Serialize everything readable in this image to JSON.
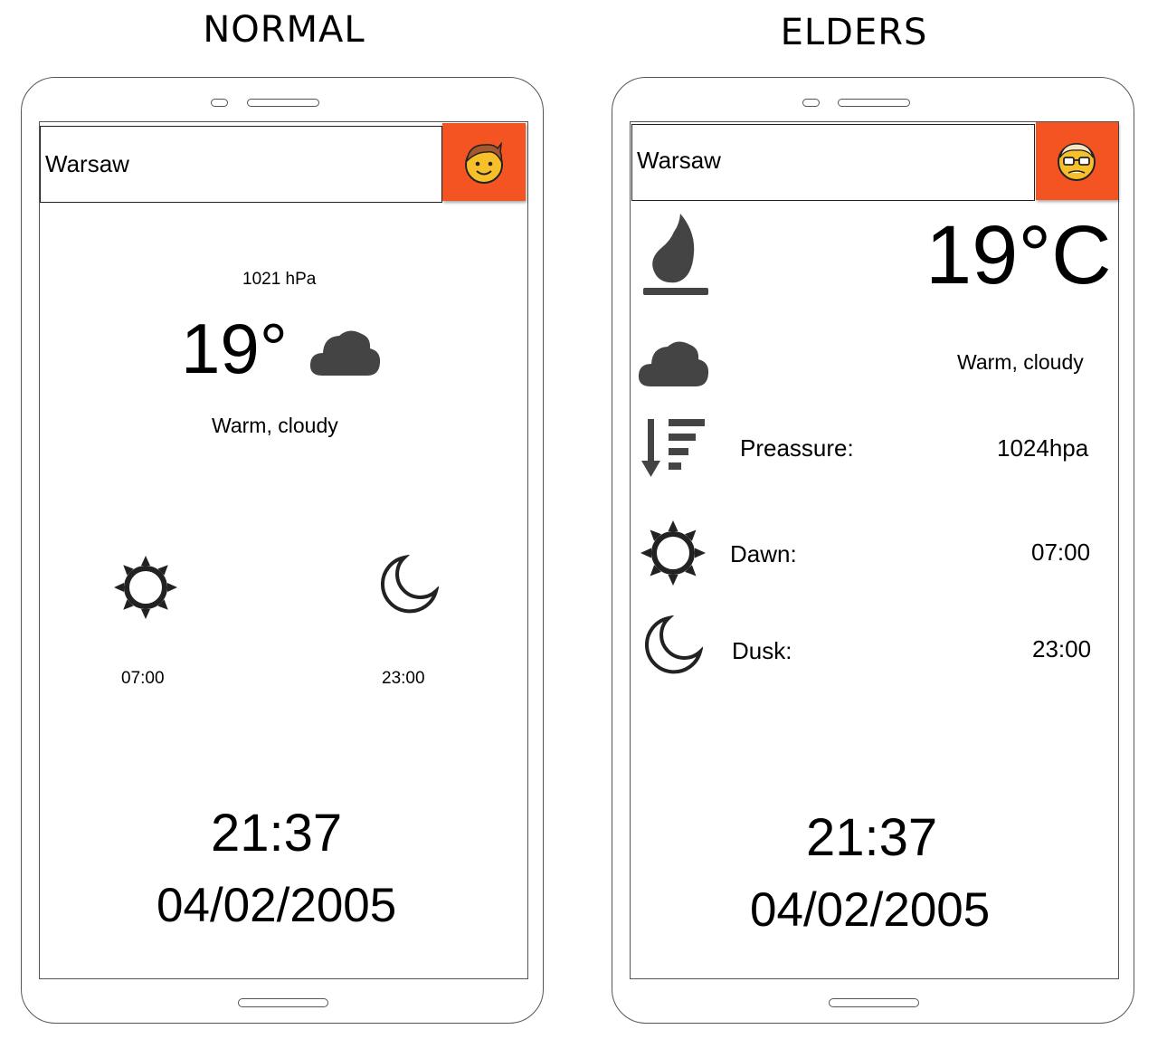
{
  "normal": {
    "mode_title": "NORMAL",
    "search": {
      "value": "Warsaw"
    },
    "profile": {
      "icon": "young-face-icon"
    },
    "pressure": "1021 hPa",
    "temperature": "19°",
    "weather_icon": "cloud-icon",
    "condition": "Warm, cloudy",
    "sunrise": {
      "icon": "sun-icon",
      "time": "07:00"
    },
    "sunset": {
      "icon": "moon-icon",
      "time": "23:00"
    },
    "clock": "21:37",
    "date": "04/02/2005"
  },
  "elders": {
    "mode_title": "ELDERS",
    "search": {
      "value": "Warsaw"
    },
    "profile": {
      "icon": "elder-face-icon"
    },
    "temperature_icon": "flame-icon",
    "temperature": "19°C",
    "weather_icon": "cloud-icon",
    "condition": "Warm, cloudy",
    "pressure": {
      "icon": "pressure-sort-icon",
      "label": "Preassure:",
      "value": "1024hpa"
    },
    "dawn": {
      "icon": "sun-icon",
      "label": "Dawn:",
      "value": "07:00"
    },
    "dusk": {
      "icon": "moon-icon",
      "label": "Dusk:",
      "value": "23:00"
    },
    "clock": "21:37",
    "date": "04/02/2005"
  },
  "colors": {
    "accent": "#f35422",
    "icon": "#444444",
    "face": "#f7c02b",
    "hair": "#a5582e"
  }
}
